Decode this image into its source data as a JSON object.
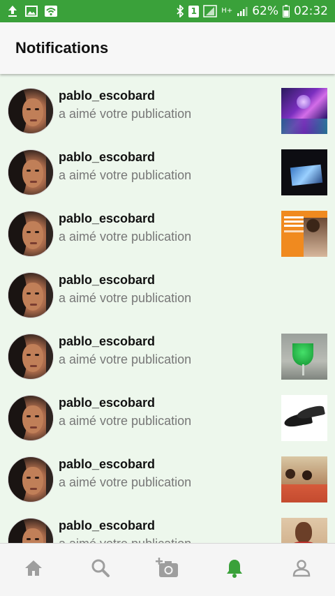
{
  "status_bar": {
    "battery": "62%",
    "time": "02:32",
    "sim_slot": "1",
    "network": "H+",
    "icons": [
      "upload-icon",
      "image-icon",
      "wifi-icon",
      "bluetooth-icon",
      "sim-icon",
      "signal-icon",
      "battery-icon"
    ]
  },
  "header": {
    "title": "Notifications"
  },
  "notifications": [
    {
      "username": "pablo_escobard",
      "action": "a aimé votre publication",
      "thumbnail": "party-purple"
    },
    {
      "username": "pablo_escobard",
      "action": "a aimé votre publication",
      "thumbnail": "dark-screen"
    },
    {
      "username": "pablo_escobard",
      "action": "a aimé votre publication",
      "thumbnail": "orange-ad"
    },
    {
      "username": "pablo_escobard",
      "action": "a aimé votre publication",
      "thumbnail": ""
    },
    {
      "username": "pablo_escobard",
      "action": "a aimé votre publication",
      "thumbnail": "green-drink"
    },
    {
      "username": "pablo_escobard",
      "action": "a aimé votre publication",
      "thumbnail": "black-shoes"
    },
    {
      "username": "pablo_escobard",
      "action": "a aimé votre publication",
      "thumbnail": "meeting"
    },
    {
      "username": "pablo_escobard",
      "action": "a aimé votre publication",
      "thumbnail": "portrait"
    }
  ],
  "bottom_nav": {
    "items": [
      "home-icon",
      "search-icon",
      "add-photo-icon",
      "notifications-bell-icon",
      "profile-icon"
    ],
    "active": "notifications-bell-icon",
    "active_color": "#3aa13a",
    "inactive_color": "#9e9e9e"
  },
  "colors": {
    "status_bar": "#3aa13a",
    "list_background": "#edf7ec"
  }
}
